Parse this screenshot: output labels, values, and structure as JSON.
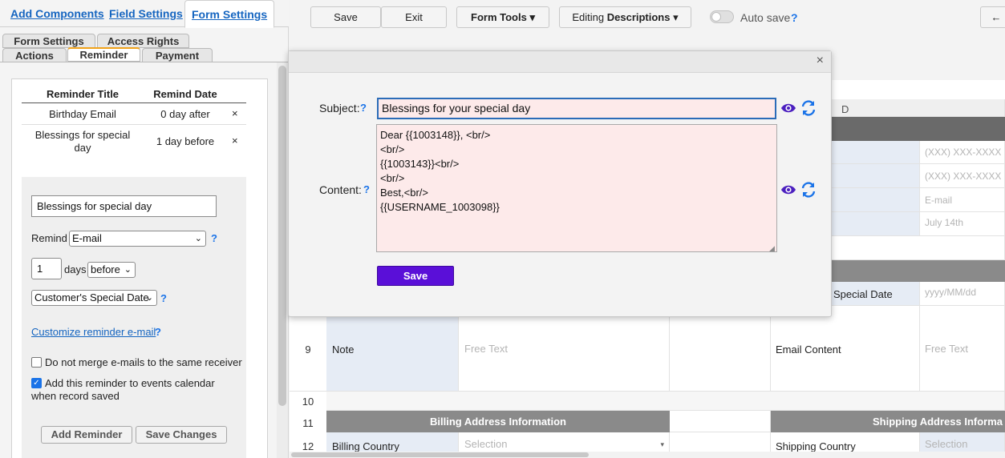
{
  "left_panel": {
    "top_tabs": [
      "Add Components",
      "Field Settings",
      "Form Settings"
    ],
    "sub_tabs_row1": [
      "Form Settings",
      "Access Rights"
    ],
    "sub_tabs_row2": [
      "Actions",
      "Reminder",
      "Payment"
    ],
    "reminder_table": {
      "headers": [
        "Reminder Title",
        "Remind Date"
      ],
      "rows": [
        {
          "title": "Birthday Email",
          "date": "0 day after",
          "delete": "×"
        },
        {
          "title_line1": "Blessings for special",
          "title_line2": "day",
          "date": "1 day before",
          "delete": "×"
        }
      ]
    },
    "editor": {
      "title_value": "Blessings for special day",
      "remind_label": "Remind",
      "remind_select": "E-mail",
      "days_value": "1",
      "days_label": "days",
      "direction_select": "before",
      "date_field_select": "Customer's Special Date",
      "help_mark": "?",
      "customize_link": "Customize reminder e-mail",
      "no_merge_label": "Do not merge e-mails to the same receiver",
      "no_merge_checked": false,
      "calendar_label_line1": "Add this reminder to events calendar",
      "calendar_label_line2": "when record saved",
      "calendar_checked": true,
      "add_button": "Add Reminder",
      "save_button": "Save Changes"
    }
  },
  "toolbar": {
    "save": "Save",
    "exit": "Exit",
    "form_tools": "Form Tools",
    "editing_prefix": "Editing",
    "editing_bold": "Descriptions",
    "auto_save": "Auto save",
    "help_mark": "?",
    "caret": "▾"
  },
  "grid": {
    "col_d": "D",
    "placeholders": {
      "phone1": "(XXX) XXX-XXXX",
      "phone2": "(XXX) XXX-XXXX",
      "email": "E-mail",
      "date": "July 14th",
      "special_date": "yyyy/MM/dd",
      "free_text_left": "Free Text",
      "free_text_right": "Free Text",
      "selection_left": "Selection",
      "selection_right": "Selection"
    },
    "rows": {
      "r9_num": "9",
      "r9_label": "Note",
      "r9_right_label": "Email Content",
      "r10_num": "10",
      "r11_num": "11",
      "r11_left_header": "Billing Address Information",
      "r11_right_header": "Shipping Address Informa",
      "r12_num": "12",
      "r12_left": "Billing Country",
      "r12_right": "Shipping Country"
    },
    "special_date_label": "Special Date"
  },
  "modal": {
    "close": "×",
    "subject_label": "Subject:",
    "content_label": "Content:",
    "help_mark": "?",
    "subject_value": "Blessings for your special day",
    "content_value": "Dear {{1003148}}, <br/>\n<br/>\n{{1003143}}<br/>\n<br/>\nBest,<br/>\n{{USERNAME_1003098}}",
    "save_button": "Save"
  },
  "colors": {
    "link_blue": "#1565c0",
    "purple": "#5a0fd8",
    "pink_field": "#fdeaea",
    "icon_blue": "#1a73e8",
    "eye_purple": "#4b1fbf"
  }
}
